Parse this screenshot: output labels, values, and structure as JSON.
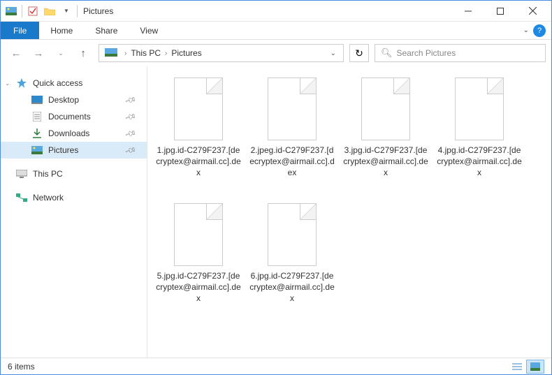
{
  "titlebar": {
    "title": "Pictures"
  },
  "ribbon": {
    "file": "File",
    "tabs": [
      "Home",
      "Share",
      "View"
    ]
  },
  "breadcrumb": {
    "items": [
      "This PC",
      "Pictures"
    ]
  },
  "search": {
    "placeholder": "Search Pictures"
  },
  "sidebar": {
    "quick_access": "Quick access",
    "items": [
      {
        "label": "Desktop",
        "pinned": true
      },
      {
        "label": "Documents",
        "pinned": true
      },
      {
        "label": "Downloads",
        "pinned": true
      },
      {
        "label": "Pictures",
        "pinned": true,
        "selected": true
      }
    ],
    "this_pc": "This PC",
    "network": "Network"
  },
  "files": [
    "1.jpg.id-C279F237.[decryptex@airmail.cc].dex",
    "2.jpeg.id-C279F237.[decryptex@airmail.cc].dex",
    "3.jpg.id-C279F237.[decryptex@airmail.cc].dex",
    "4.jpg.id-C279F237.[decryptex@airmail.cc].dex",
    "5.jpg.id-C279F237.[decryptex@airmail.cc].dex",
    "6.jpg.id-C279F237.[decryptex@airmail.cc].dex"
  ],
  "statusbar": {
    "count": "6 items"
  }
}
